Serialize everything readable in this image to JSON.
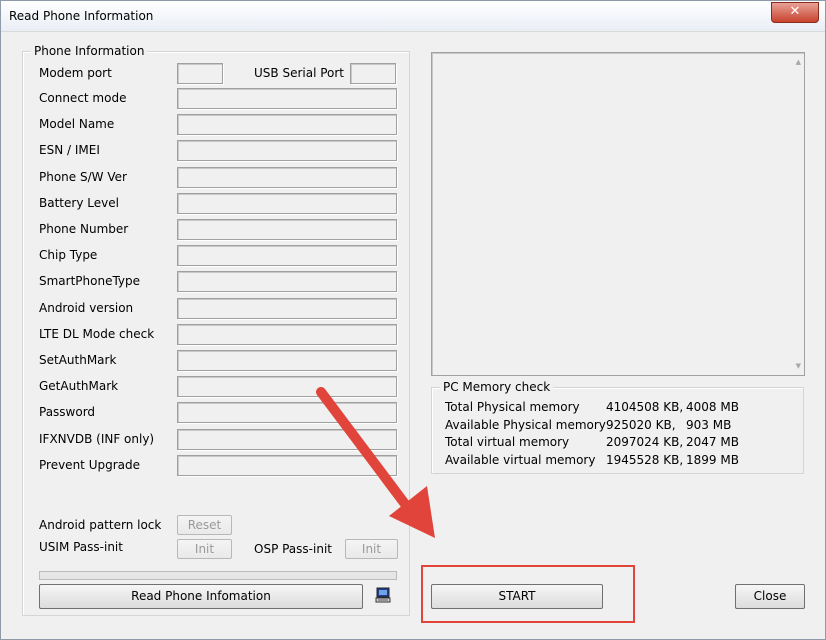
{
  "window": {
    "title": "Read Phone Information",
    "close_glyph": "✕"
  },
  "phone_info": {
    "group_title": "Phone Information",
    "modem_port_label": "Modem port",
    "usb_serial_port_label": "USB Serial Port",
    "fields": [
      {
        "label": "Connect mode",
        "value": ""
      },
      {
        "label": "Model Name",
        "value": ""
      },
      {
        "label": "ESN / IMEI",
        "value": ""
      },
      {
        "label": "Phone S/W Ver",
        "value": ""
      },
      {
        "label": "Battery Level",
        "value": ""
      },
      {
        "label": "Phone Number",
        "value": ""
      },
      {
        "label": "Chip Type",
        "value": ""
      },
      {
        "label": "SmartPhoneType",
        "value": ""
      },
      {
        "label": "Android version",
        "value": ""
      },
      {
        "label": "LTE DL Mode check",
        "value": ""
      },
      {
        "label": "SetAuthMark",
        "value": ""
      },
      {
        "label": "GetAuthMark",
        "value": ""
      },
      {
        "label": "Password",
        "value": ""
      },
      {
        "label": "IFXNVDB (INF only)",
        "value": ""
      },
      {
        "label": "Prevent Upgrade",
        "value": ""
      }
    ],
    "android_pattern_lock_label": "Android pattern lock",
    "reset_button": "Reset",
    "usim_pass_init_label": "USIM Pass-init",
    "usim_init_button": "Init",
    "osp_pass_init_label": "OSP Pass-init",
    "osp_init_button": "Init",
    "progress": 0,
    "read_button": "Read Phone Infomation",
    "computer_icon": "computer-icon"
  },
  "memory": {
    "group_title": "PC Memory check",
    "rows": [
      {
        "name": "Total Physical memory",
        "kb": "4104508 KB,",
        "mb": "4008 MB"
      },
      {
        "name": "Available Physical memory",
        "kb": "925020 KB,",
        "mb": "903 MB"
      },
      {
        "name": "Total virtual memory",
        "kb": "2097024 KB,",
        "mb": "2047 MB"
      },
      {
        "name": "Available virtual memory",
        "kb": "1945528 KB,",
        "mb": "1899 MB"
      }
    ]
  },
  "buttons": {
    "start": "START",
    "close": "Close"
  },
  "colors": {
    "annotation": "#e0443a"
  }
}
